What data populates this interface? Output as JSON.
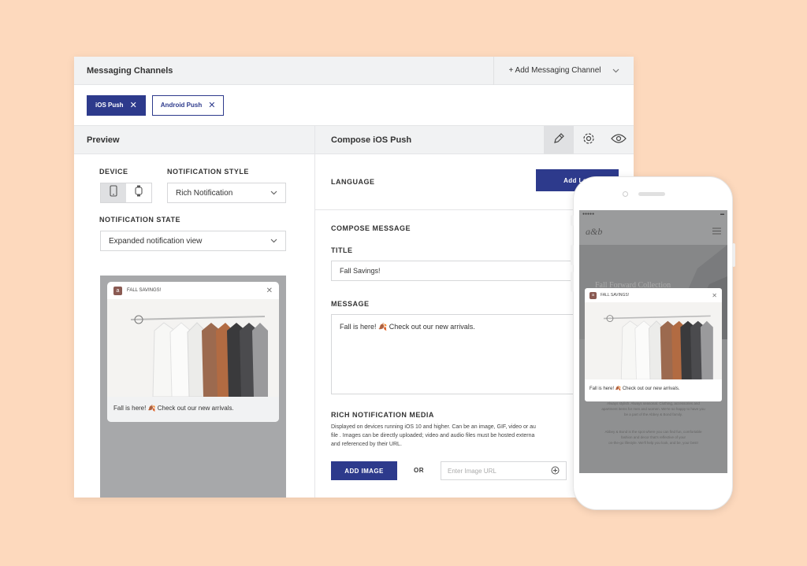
{
  "header": {
    "title": "Messaging Channels",
    "add_channel_label": "+ Add Messaging Channel"
  },
  "channels": [
    {
      "label": "iOS Push",
      "active": true
    },
    {
      "label": "Android Push",
      "active": false
    }
  ],
  "preview": {
    "title": "Preview",
    "device_label": "DEVICE",
    "style_label": "NOTIFICATION STYLE",
    "style_value": "Rich Notification",
    "state_label": "NOTIFICATION STATE",
    "state_value": "Expanded notification view",
    "notification": {
      "app_initial": "a",
      "title": "FALL SAVINGS!",
      "body": "Fall is here! 🍂 Check out our new arrivals."
    }
  },
  "compose": {
    "title": "Compose iOS Push",
    "language_label": "LANGUAGE",
    "add_language_label": "Add Lan",
    "compose_message_label": "COMPOSE MESSAGE",
    "title_label": "TITLE",
    "title_value": "Fall Savings!",
    "message_label": "MESSAGE",
    "message_value": "Fall is here! 🍂 Check out our new arrivals.",
    "media_label": "RICH NOTIFICATION MEDIA",
    "media_desc_1": "Displayed on devices running iOS 10 and higher. Can be an  image, GIF, video or au",
    "media_desc_2": "file . Images can be directly uploaded; video and audio files must be hosted externa",
    "media_desc_3": "and referenced by their URL.",
    "add_image_label": "ADD IMAGE",
    "or_label": "OR",
    "image_url_placeholder": "Enter Image URL"
  },
  "phone": {
    "logo": "a&b",
    "hero_text": "Fall Forward Collection",
    "notification_title": "FALL SAVINGS!",
    "notification_body": "Fall is here! 🍂 Check out our new arrivals.",
    "site_text_1": "Always stylish. Always seasonal. Clothing, accessories and",
    "site_text_2": "apartment items for men and women. We're so happy to have you",
    "site_text_3": "be a part of the Abbey & Bond family.",
    "site_text_4": "Abbey & Bond is the spot where you can find fun, comfortable",
    "site_text_5": "fashion and decor that's reflective of your",
    "site_text_6": "on-the-go lifestyle. We'll help you look, and be, your best!"
  },
  "colors": {
    "background": "#fdd9bd",
    "accent": "#2d3a8c",
    "preview_bg": "#a7a8aa"
  },
  "icons": {
    "edit": "pencil-icon",
    "settings": "gear-icon",
    "preview": "eye-icon",
    "phone": "phone-icon",
    "watch": "watch-icon",
    "add_url": "plus-circle-icon"
  }
}
